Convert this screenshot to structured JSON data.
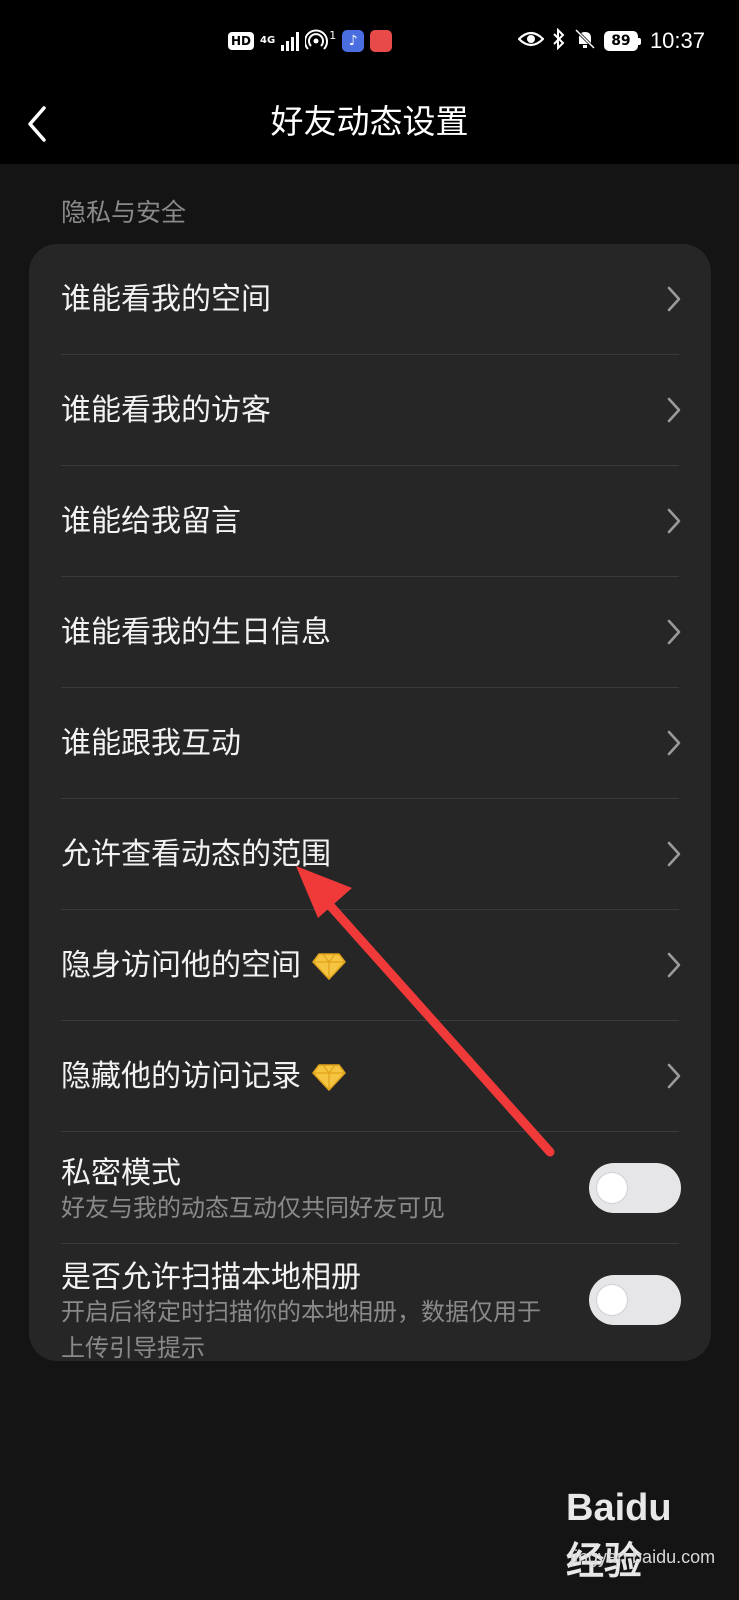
{
  "status_bar": {
    "hd": "HD",
    "network": "4G",
    "hotspot_count": "1",
    "battery": "89",
    "time": "10:37",
    "icons": [
      "hd-icon",
      "signal-icon",
      "hotspot-icon",
      "music-app-icon",
      "huawei-app-icon",
      "eye-icon",
      "bluetooth-icon",
      "mute-icon",
      "battery-icon"
    ]
  },
  "header": {
    "title": "好友动态设置",
    "back_icon": "chevron-left-icon"
  },
  "section": {
    "label": "隐私与安全"
  },
  "menu_items": [
    {
      "label": "谁能看我的空间",
      "badge": false
    },
    {
      "label": "谁能看我的访客",
      "badge": false
    },
    {
      "label": "谁能给我留言",
      "badge": false
    },
    {
      "label": "谁能看我的生日信息",
      "badge": false
    },
    {
      "label": "谁能跟我互动",
      "badge": false
    },
    {
      "label": "允许查看动态的范围",
      "badge": false
    },
    {
      "label": "隐身访问他的空间",
      "badge": true
    },
    {
      "label": "隐藏他的访问记录",
      "badge": true
    }
  ],
  "toggles": [
    {
      "title": "私密模式",
      "subtitle": "好友与我的动态互动仅共同好友可见",
      "on": false
    },
    {
      "title": "是否允许扫描本地相册",
      "subtitle": "开启后将定时扫描你的本地相册，数据仅用于上传引导提示",
      "on": false
    }
  ],
  "watermark": {
    "logo": "Baidu经验",
    "site": "jingyan.baidu.com"
  },
  "colors": {
    "background": "#141414",
    "card": "#262626",
    "annotation_arrow": "#f03a3a",
    "badge_gem": "#f5c542"
  }
}
